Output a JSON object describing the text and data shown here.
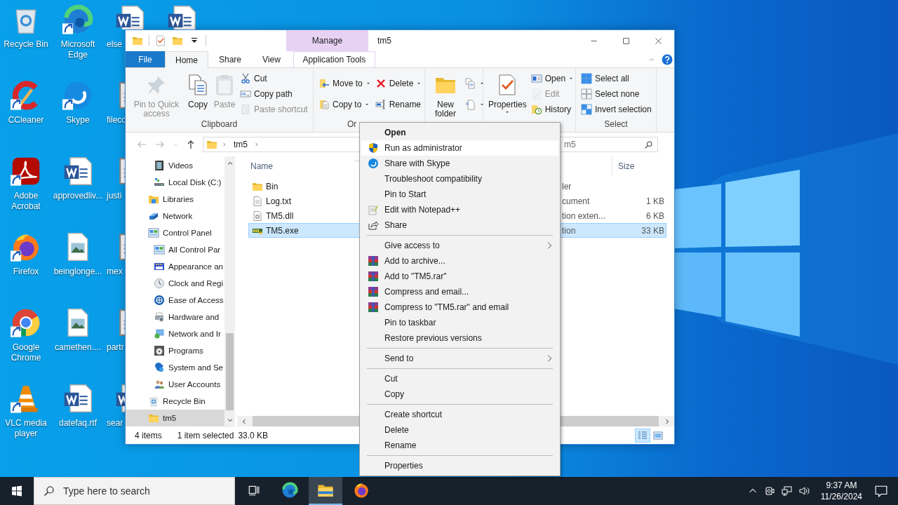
{
  "desktop": {
    "columns": [
      {
        "icons": [
          {
            "label": "Recycle Bin",
            "kind": "recycle",
            "shortcut": false
          },
          {
            "label": "CCleaner",
            "kind": "ccleaner",
            "shortcut": true
          },
          {
            "label": "Adobe Acrobat",
            "kind": "acrobat",
            "shortcut": true
          },
          {
            "label": "Firefox",
            "kind": "firefox",
            "shortcut": true
          },
          {
            "label": "Google Chrome",
            "kind": "chrome",
            "shortcut": true
          },
          {
            "label": "VLC media player",
            "kind": "vlc",
            "shortcut": true
          }
        ]
      },
      {
        "icons": [
          {
            "label": "Microsoft Edge",
            "kind": "edge",
            "shortcut": true
          },
          {
            "label": "Skype",
            "kind": "skype",
            "shortcut": true
          },
          {
            "label": "approvedliv...",
            "kind": "word",
            "shortcut": false
          },
          {
            "label": "beinglonge...",
            "kind": "image",
            "shortcut": false
          },
          {
            "label": "camethen....",
            "kind": "image",
            "shortcut": false
          },
          {
            "label": "datefaq.rtf",
            "kind": "word",
            "shortcut": false
          }
        ]
      },
      {
        "icons": [
          {
            "label": "else",
            "kind": "word",
            "shortcut": false
          },
          {
            "label": "fileco",
            "kind": "doc",
            "shortcut": false
          },
          {
            "label": "justi",
            "kind": "doc",
            "shortcut": false
          },
          {
            "label": "mex",
            "kind": "doc",
            "shortcut": false
          },
          {
            "label": "partr",
            "kind": "doc",
            "shortcut": false
          },
          {
            "label": "sear",
            "kind": "word",
            "shortcut": false
          }
        ]
      },
      {
        "icons": [
          {
            "kind": "word",
            "shortcut": false
          }
        ]
      }
    ]
  },
  "window": {
    "title": "tm5",
    "contextual_tab": "Manage",
    "tabs": [
      {
        "label": "File",
        "kind": "file",
        "selected": false
      },
      {
        "label": "Home",
        "kind": "tab",
        "selected": true
      },
      {
        "label": "Share",
        "kind": "tab",
        "selected": false
      },
      {
        "label": "View",
        "kind": "tab",
        "selected": false
      },
      {
        "label": "Application Tools",
        "kind": "contextual",
        "selected": false
      }
    ],
    "ribbon": [
      {
        "label": "Clipboard",
        "large": [
          {
            "label": "Pin to Quick access",
            "kind": "pin",
            "disabled": true,
            "dropdown": false
          },
          {
            "label": "Copy",
            "kind": "copy",
            "disabled": false,
            "dropdown": false
          },
          {
            "label": "Paste",
            "kind": "paste",
            "disabled": true,
            "dropdown": false
          }
        ],
        "columns": [
          [
            {
              "label": "Cut",
              "kind": "scissors",
              "disabled": false,
              "dropdown": false
            },
            {
              "label": "Copy path",
              "kind": "copypath",
              "disabled": false,
              "dropdown": false
            },
            {
              "label": "Paste shortcut",
              "kind": "pasteshortcut",
              "disabled": true,
              "dropdown": false
            }
          ]
        ]
      },
      {
        "label": "Or",
        "columns": [
          [
            {
              "label": "Move to",
              "kind": "moveto",
              "disabled": false,
              "dropdown": true
            },
            {
              "label": "Copy to",
              "kind": "copyto",
              "disabled": false,
              "dropdown": true
            }
          ],
          [
            {
              "label": "Delete",
              "kind": "deletex",
              "disabled": false,
              "dropdown": true
            },
            {
              "label": "Rename",
              "kind": "rename",
              "disabled": false,
              "dropdown": false
            }
          ]
        ]
      },
      {
        "large": [
          {
            "label": "New folder",
            "kind": "folder",
            "disabled": false
          }
        ],
        "columns": [
          [
            {
              "kind": "newitem",
              "disabled": false,
              "dropdown": true
            },
            {
              "kind": "easyaccess",
              "disabled": false,
              "dropdown": true
            }
          ]
        ]
      },
      {
        "large": [
          {
            "label": "Properties",
            "kind": "properties",
            "disabled": false,
            "dropdown": true
          }
        ],
        "columns": [
          [
            {
              "label": "Open",
              "kind": "open",
              "disabled": false,
              "dropdown": true
            },
            {
              "label": "Edit",
              "kind": "edit",
              "disabled": true,
              "dropdown": false
            },
            {
              "label": "History",
              "kind": "history",
              "disabled": false,
              "dropdown": false
            }
          ]
        ]
      },
      {
        "label": "Select",
        "columns": [
          [
            {
              "label": "Select all",
              "kind": "selectall",
              "disabled": false,
              "dropdown": false
            },
            {
              "label": "Select none",
              "kind": "selectnone",
              "disabled": false,
              "dropdown": false
            },
            {
              "label": "Invert selection",
              "kind": "invert",
              "disabled": false,
              "dropdown": false
            }
          ]
        ]
      }
    ],
    "address": {
      "path": [
        "tm5"
      ]
    },
    "search": {
      "value": "m5"
    },
    "nav": [
      {
        "children": [
          {
            "label": "Videos",
            "kind": "video",
            "selected": false
          },
          {
            "label": "Local Disk (C:)",
            "kind": "disk",
            "selected": false
          }
        ]
      },
      {
        "label": "Libraries",
        "kind": "libraries",
        "selected": false
      },
      {
        "label": "Network",
        "kind": "network",
        "selected": false
      },
      {
        "label": "Control Panel",
        "kind": "control",
        "selected": false,
        "children": [
          {
            "label": "All Control Par",
            "kind": "control",
            "selected": false
          },
          {
            "label": "Appearance an",
            "kind": "appearance",
            "selected": false
          },
          {
            "label": "Clock and Regi",
            "kind": "clock",
            "selected": false
          },
          {
            "label": "Ease of Access",
            "kind": "ease",
            "selected": false
          },
          {
            "label": "Hardware and",
            "kind": "hardware",
            "selected": false
          },
          {
            "label": "Network and Ir",
            "kind": "netint",
            "selected": false
          },
          {
            "label": "Programs",
            "kind": "programs",
            "selected": false
          },
          {
            "label": "System and Se",
            "kind": "system",
            "selected": false
          },
          {
            "label": "User Accounts",
            "kind": "users",
            "selected": false
          }
        ]
      },
      {
        "label": "Recycle Bin",
        "kind": "recycle",
        "selected": false
      },
      {
        "label": "tm5",
        "kind": "folder",
        "selected": true
      }
    ],
    "columns": {
      "name": "Name",
      "size": "Size"
    },
    "files": [
      {
        "name": "Bin",
        "kind": "folder",
        "type": "ler",
        "selected": false
      },
      {
        "name": "Log.txt",
        "kind": "text",
        "type": "cument",
        "size": "1 KB",
        "selected": false
      },
      {
        "name": "TM5.dll",
        "kind": "library",
        "type": "tion exten...",
        "size": "6 KB",
        "selected": false
      },
      {
        "name": "TM5.exe",
        "kind": "program",
        "type": "tion",
        "size": "33 KB",
        "selected": true
      }
    ],
    "status": {
      "count": "4 items",
      "selection": "1 item selected",
      "size": "33.0 KB"
    },
    "views": [
      {
        "kind": "details",
        "selected": true
      },
      {
        "kind": "tiles",
        "selected": false
      }
    ]
  },
  "context_menu": [
    {
      "label": "Open",
      "kind": "default",
      "selected": false
    },
    {
      "label": "Run as administrator",
      "kind": "shield",
      "selected": true
    },
    {
      "label": "Share with Skype",
      "kind": "skype",
      "selected": false
    },
    {
      "label": "Troubleshoot compatibility",
      "kind": "plain",
      "selected": false
    },
    {
      "label": "Pin to Start",
      "kind": "plain",
      "selected": false
    },
    {
      "label": "Edit with Notepad++",
      "kind": "notepad",
      "selected": false
    },
    {
      "label": "Share",
      "kind": "share",
      "selected": false
    },
    {
      "kind": "separator"
    },
    {
      "label": "Give access to",
      "kind": "submenu",
      "selected": false
    },
    {
      "label": "Add to archive...",
      "kind": "rar",
      "selected": false
    },
    {
      "label": "Add to \"TM5.rar\"",
      "kind": "rar",
      "selected": false
    },
    {
      "label": "Compress and email...",
      "kind": "rar",
      "selected": false
    },
    {
      "label": "Compress to \"TM5.rar\" and email",
      "kind": "rar",
      "selected": false
    },
    {
      "label": "Pin to taskbar",
      "kind": "plain",
      "selected": false
    },
    {
      "label": "Restore previous versions",
      "kind": "plain",
      "selected": false
    },
    {
      "kind": "separator"
    },
    {
      "label": "Send to",
      "kind": "submenu",
      "selected": false
    },
    {
      "kind": "separator"
    },
    {
      "label": "Cut",
      "kind": "plain",
      "selected": false
    },
    {
      "label": "Copy",
      "kind": "plain",
      "selected": false
    },
    {
      "kind": "separator"
    },
    {
      "label": "Create shortcut",
      "kind": "plain",
      "selected": false
    },
    {
      "label": "Delete",
      "kind": "plain",
      "selected": false
    },
    {
      "label": "Rename",
      "kind": "plain",
      "selected": false
    },
    {
      "kind": "separator"
    },
    {
      "label": "Properties",
      "kind": "plain",
      "selected": false
    }
  ],
  "taskbar": {
    "search": {
      "placeholder": "Type here to search"
    },
    "apps": [
      {
        "kind": "taskview",
        "active": false
      },
      {
        "kind": "edge",
        "active": false
      },
      {
        "kind": "explorer",
        "active": true
      },
      {
        "kind": "firefox",
        "active": false
      }
    ],
    "time": "9:37 AM",
    "date": "11/26/2024"
  }
}
